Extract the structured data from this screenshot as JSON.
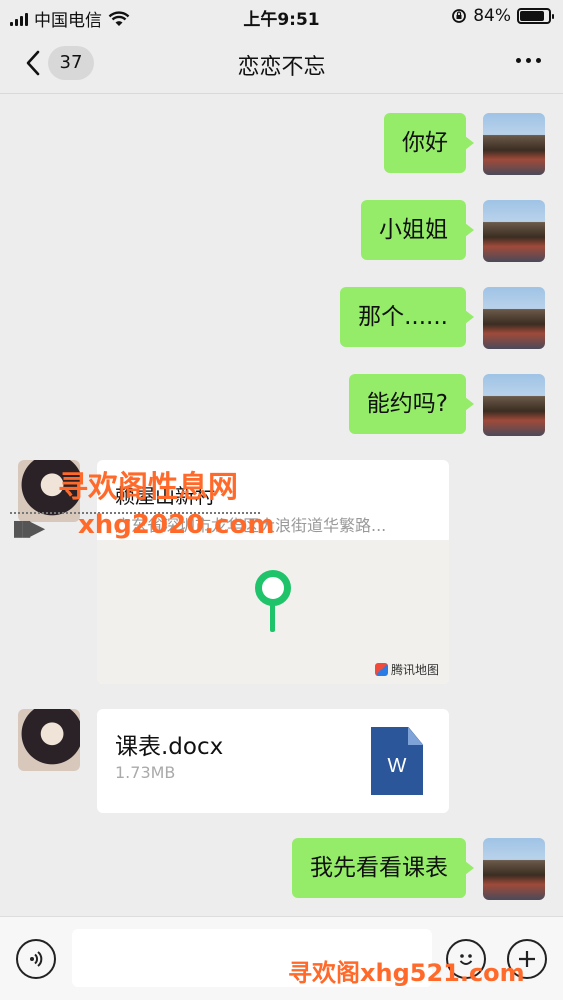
{
  "status_bar": {
    "carrier": "中国电信",
    "time": "上午9:51",
    "battery": "84%",
    "battery_level": 0.84
  },
  "header": {
    "unread_count": "37",
    "title": "恋恋不忘"
  },
  "messages": [
    {
      "text": "你好"
    },
    {
      "text": "小姐姐"
    },
    {
      "text": "那个......"
    },
    {
      "text": "能约吗?"
    }
  ],
  "location": {
    "name": "赖屋山新村",
    "address": "广东省深圳市龙华区大浪街道华繁路...",
    "map_brand": "腾讯地图"
  },
  "file": {
    "name": "课表.docx",
    "size": "1.73MB",
    "icon_letter": "W"
  },
  "last_message": {
    "text": "我先看看课表"
  },
  "watermark": {
    "line1": "寻欢阁性息网",
    "line2": "xhg2020.com",
    "footer": "寻欢阁xhg521.com"
  },
  "colors": {
    "my_bubble": "#95ec69",
    "background": "#ededed",
    "pin": "#1fc46a",
    "docx": "#2b579a",
    "watermark": "#ff6a2a"
  }
}
